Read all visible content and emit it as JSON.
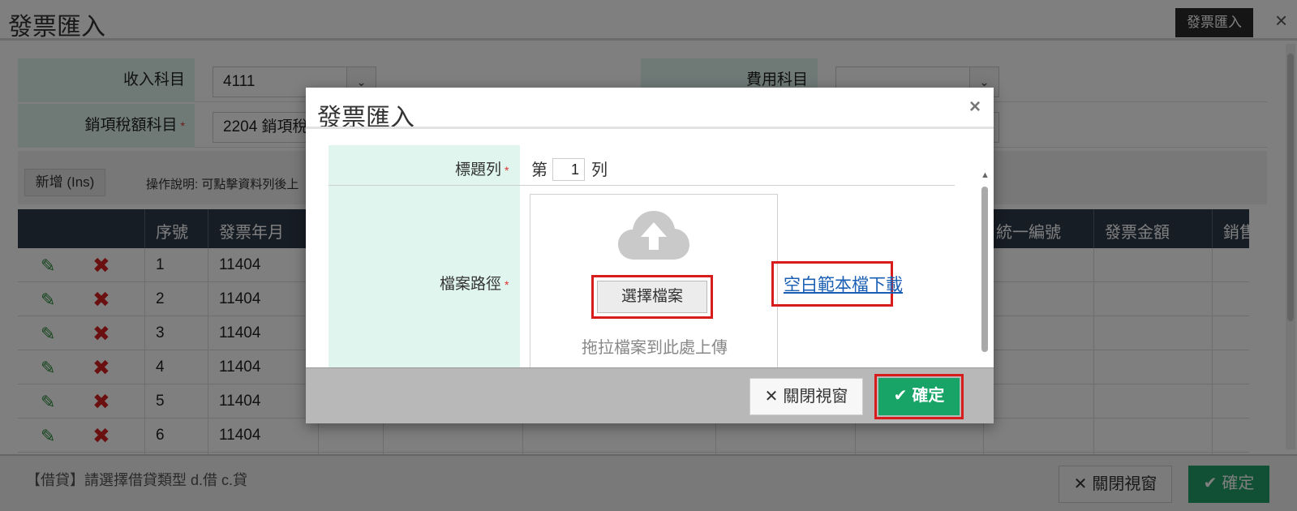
{
  "page": {
    "title": "發票匯入",
    "header_button": "發票匯入",
    "close_icon": "×",
    "form": {
      "income_label": "收入科目",
      "income_value": "4111",
      "expense_label": "費用科目",
      "expense_value": "",
      "tax_label": "銷項稅額科目",
      "tax_value": "2204 銷項稅",
      "required_mark": "*"
    },
    "toolbar": {
      "add_label": "新增 (Ins)",
      "op_note": "操作說明: 可點擊資料列後上"
    },
    "grid": {
      "columns": [
        "序號",
        "發票年月",
        "統一編號",
        "發票金額",
        "銷售"
      ],
      "rows": [
        {
          "num": "1",
          "ym": "11404"
        },
        {
          "num": "2",
          "ym": "11404"
        },
        {
          "num": "3",
          "ym": "11404"
        },
        {
          "num": "4",
          "ym": "11404"
        },
        {
          "num": "5",
          "ym": "11404"
        },
        {
          "num": "6",
          "ym": "11404"
        }
      ]
    },
    "footer": {
      "note": "【借貸】請選擇借貸類型 d.借 c.貸",
      "close_label": "關閉視窗",
      "ok_label": "確定"
    }
  },
  "modal": {
    "title": "發票匯入",
    "close_icon": "×",
    "header_row_label": "標題列",
    "header_row_prefix": "第",
    "header_row_value": "1",
    "header_row_suffix": "列",
    "file_path_label": "檔案路徑",
    "required_mark": "*",
    "choose_file_label": "選擇檔案",
    "drop_hint": "拖拉檔案到此處上傳",
    "template_link": "空白範本檔下載",
    "close_label": "關閉視窗",
    "ok_label": "確定",
    "icons": {
      "upload": "cloud-upload-icon",
      "close": "close-icon",
      "check": "check-icon"
    },
    "colors": {
      "ok_button": "#17a466",
      "highlight": "#d81b1b",
      "label_bg": "#dff5ee",
      "link": "#1a5fb4"
    }
  }
}
